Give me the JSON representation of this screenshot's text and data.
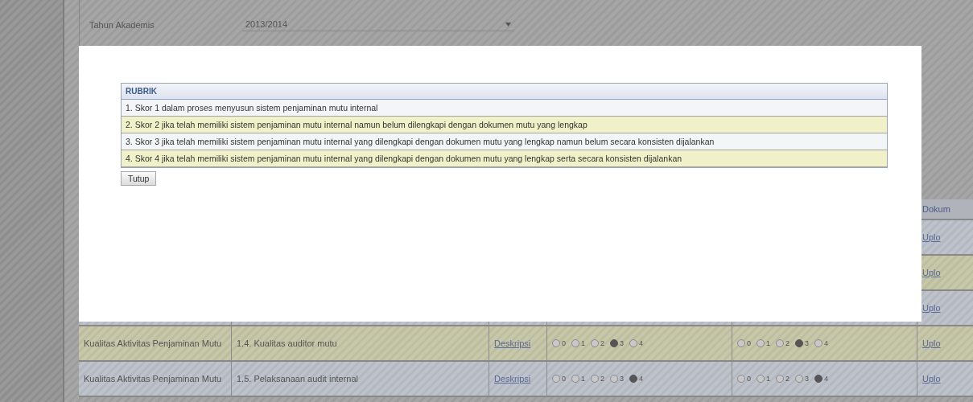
{
  "form": [
    {
      "label": "Tahun Akademis",
      "value": "2013/2014"
    }
  ],
  "table": {
    "columns": [
      {
        "label": "Dokum"
      }
    ],
    "rows": [
      {
        "document_link": "Uplo"
      },
      {
        "document_link": "Uplo"
      },
      {
        "document_link": "Uplo"
      },
      {
        "category": "Kualitas Aktivitas Penjaminan Mutu",
        "indicator": "1.4. Kualitas auditor mutu",
        "description_link": "Deskripsi",
        "score_a": [
          {
            "label": "0",
            "selected": false
          },
          {
            "label": "1",
            "selected": false
          },
          {
            "label": "2",
            "selected": false
          },
          {
            "label": "3",
            "selected": true
          },
          {
            "label": "4",
            "selected": false
          }
        ],
        "score_b": [
          {
            "label": "0",
            "selected": false
          },
          {
            "label": "1",
            "selected": false
          },
          {
            "label": "2",
            "selected": false
          },
          {
            "label": "3",
            "selected": true
          },
          {
            "label": "4",
            "selected": false
          }
        ],
        "document_link": "Uplo"
      },
      {
        "category": "Kualitas Aktivitas Penjaminan Mutu",
        "indicator": "1.5. Pelaksanaan audit internal",
        "description_link": "Deskripsi",
        "score_a": [
          {
            "label": "0",
            "selected": false
          },
          {
            "label": "1",
            "selected": false
          },
          {
            "label": "2",
            "selected": false
          },
          {
            "label": "3",
            "selected": false
          },
          {
            "label": "4",
            "selected": true
          }
        ],
        "score_b": [
          {
            "label": "0",
            "selected": false
          },
          {
            "label": "1",
            "selected": false
          },
          {
            "label": "2",
            "selected": false
          },
          {
            "label": "3",
            "selected": false
          },
          {
            "label": "4",
            "selected": true
          }
        ],
        "document_link": "Uplo"
      }
    ]
  },
  "dialog": {
    "header": "RUBRIK",
    "items": [
      "1. Skor 1 dalam proses menyusun sistem penjaminan mutu internal",
      "2. Skor 2 jika telah memiliki sistem penjaminan mutu internal namun belum dilengkapi dengan dokumen mutu yang lengkap",
      "3. Skor 3 jika telah memiliki sistem penjaminan mutu internal yang dilengkapi dengan dokumen mutu yang lengkap namun belum secara konsisten dijalankan",
      "4. Skor 4 jika telah memiliki sistem penjaminan mutu internal yang dilengkapi dengan dokumen mutu yang lengkap serta secara konsisten dijalankan"
    ],
    "close_button": "Tutup"
  }
}
